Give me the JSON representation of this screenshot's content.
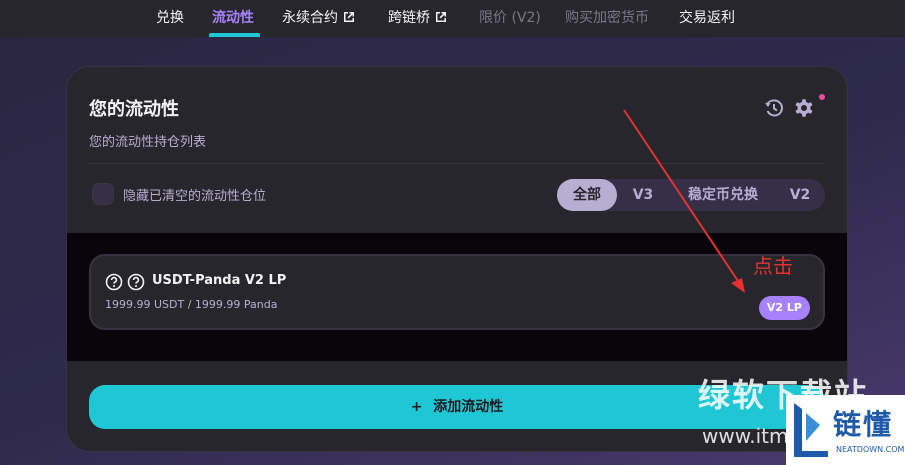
{
  "nav": {
    "items": [
      {
        "label": "兑换",
        "state": "normal"
      },
      {
        "label": "流动性",
        "state": "active"
      },
      {
        "label": "永续合约",
        "state": "normal",
        "external": true
      },
      {
        "label": "跨链桥",
        "state": "normal",
        "external": true
      },
      {
        "label": "限价 (V2)",
        "state": "disabled"
      },
      {
        "label": "购买加密货币",
        "state": "disabled"
      },
      {
        "label": "交易返利",
        "state": "normal"
      }
    ],
    "external_icon": "external-link-icon"
  },
  "card": {
    "title": "您的流动性",
    "subtitle": "您的流动性持仓列表",
    "icons": [
      "history-icon",
      "gear-icon"
    ],
    "hide_closed_label": "隐藏已清空的流动性仓位",
    "hide_closed_checked": false,
    "filters": [
      "全部",
      "V3",
      "稳定币兑换",
      "V2"
    ],
    "active_filter": "全部"
  },
  "positions": [
    {
      "name": "USDT-Panda V2 LP",
      "amount": "1999.99 USDT / 1999.99 Panda",
      "badge": "V2 LP"
    }
  ],
  "add_button": {
    "icon": "+",
    "label": "添加流动性"
  },
  "annotation": {
    "text": "点击",
    "color": "#e5322f"
  },
  "watermark": {
    "site_text": "绿软下载站",
    "url_text": "www.itm",
    "logo_name": "链懂",
    "logo_sub": "NEATDOWN.COM"
  },
  "colors": {
    "accent": "#1fc7d4",
    "secondary": "#a881fc",
    "card_bg": "#27262c",
    "text_subtle": "#b8add2",
    "notification": "#ed4b9e"
  }
}
